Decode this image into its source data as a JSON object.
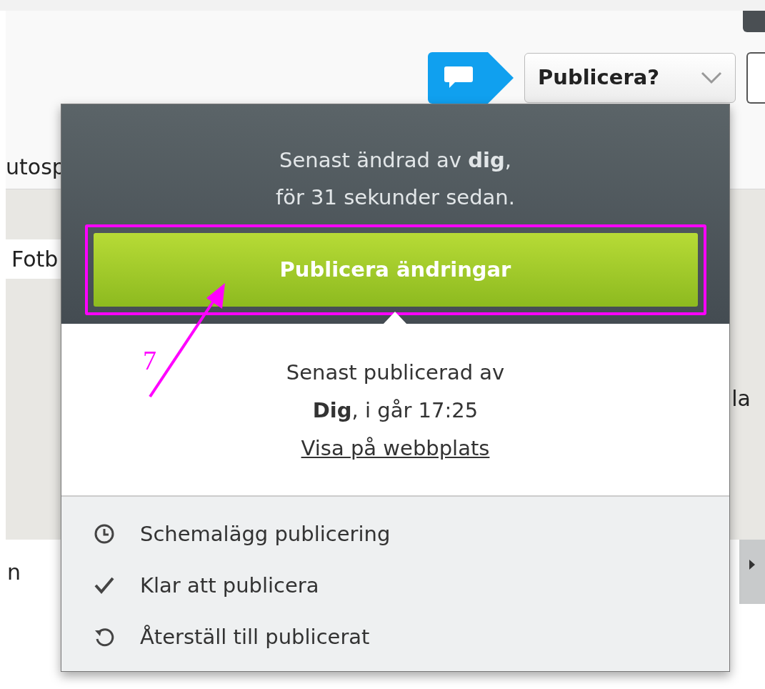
{
  "toolbar": {
    "publish_button": "Publicera?"
  },
  "background": {
    "top_left_text": "utosp",
    "field_value": "Fotb",
    "right_text": "la",
    "bottom_left_text": "n"
  },
  "popover": {
    "changed_lines": [
      "Senast ändrad av **dig**,",
      "för 31 sekunder sedan."
    ],
    "publish_button": "Publicera ändringar",
    "published_lines": [
      "Senast publicerad av",
      "**Dig**, i går 17:25"
    ],
    "view_link": "Visa på webbplats",
    "actions": [
      {
        "kind": "schedule",
        "label": "Schemalägg publicering"
      },
      {
        "kind": "ready",
        "label": "Klar att publicera"
      },
      {
        "kind": "revert",
        "label": "Återställ till publicerat"
      }
    ]
  },
  "annotation": {
    "number": "7"
  }
}
